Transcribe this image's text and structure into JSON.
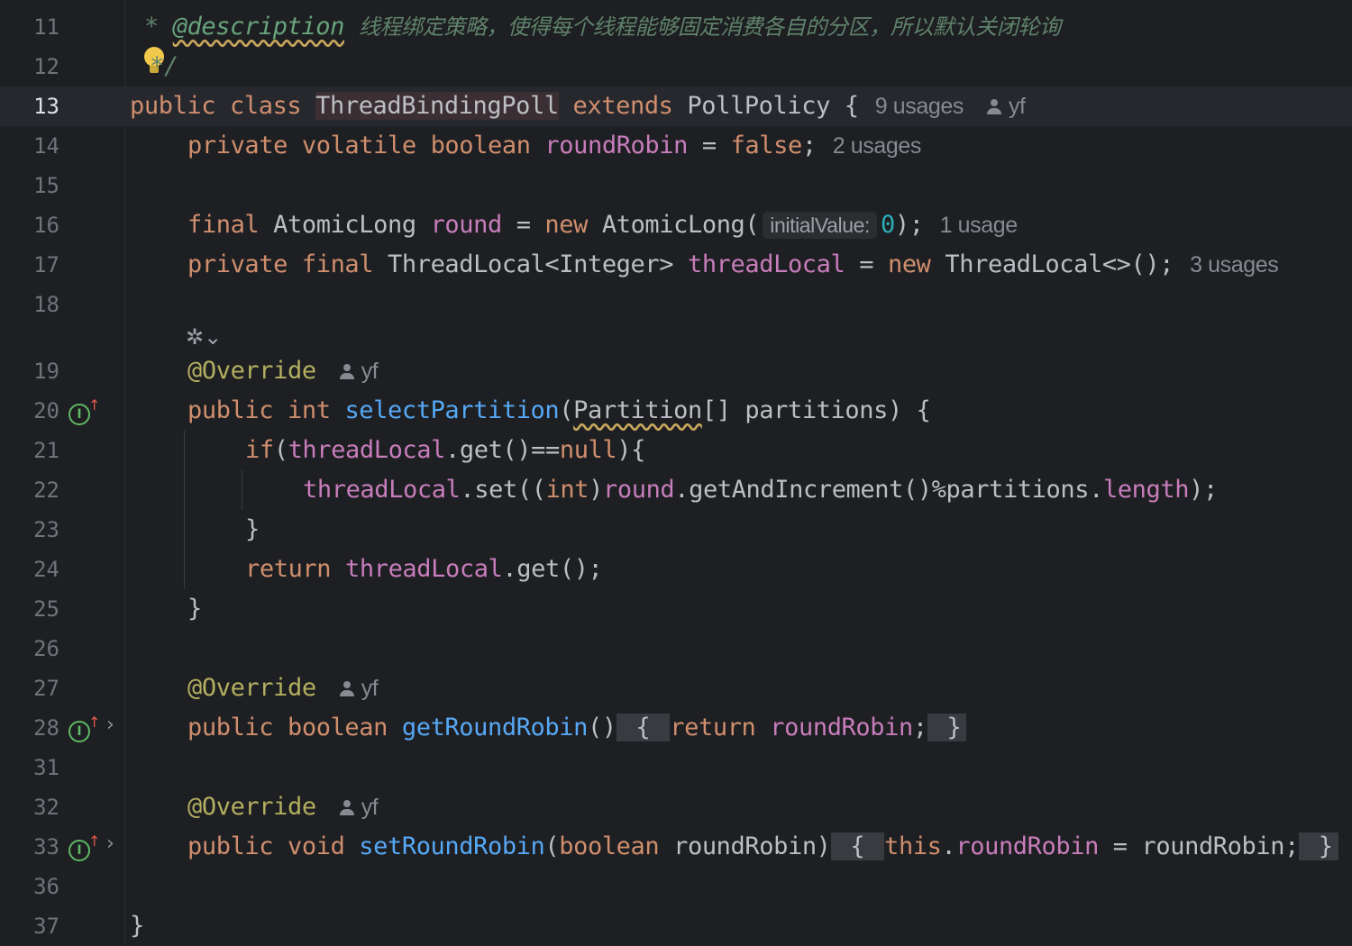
{
  "editor": {
    "line_numbers": [
      "11",
      "12",
      "13",
      "14",
      "15",
      "16",
      "17",
      "18",
      "19",
      "20",
      "21",
      "22",
      "23",
      "24",
      "25",
      "26",
      "27",
      "28",
      "31",
      "32",
      "33",
      "36",
      "37"
    ],
    "lines": {
      "l11": {
        "star": "*",
        "tag": "@description",
        "text": "线程绑定策略，使得每个线程能够固定消费各自的分区，所以默认关闭轮询"
      },
      "l12": {
        "text": "*/"
      },
      "l13": {
        "kw1": "public",
        "kw2": "class",
        "class_name": "ThreadBindingPoll",
        "kw3": "extends",
        "super": "PollPolicy",
        "brace": "{",
        "hint": "9 usages",
        "author": "yf"
      },
      "l14": {
        "kw1": "private",
        "kw2": "volatile",
        "kw3": "boolean",
        "field": "roundRobin",
        "eq": "=",
        "val": "false",
        "semi": ";",
        "hint": "2 usages"
      },
      "l16": {
        "kw1": "final",
        "type": "AtomicLong",
        "field": "round",
        "eq": "=",
        "kw2": "new",
        "ctor": "AtomicLong(",
        "param_hint": "initialValue:",
        "num": "0",
        "end": ");",
        "hint": "1 usage"
      },
      "l17": {
        "kw1": "private",
        "kw2": "final",
        "type": "ThreadLocal<Integer>",
        "field": "threadLocal",
        "eq": "=",
        "kw3": "new",
        "ctor": "ThreadLocal<>();",
        "hint": "3 usages"
      },
      "l19": {
        "ann": "@Override",
        "author": "yf"
      },
      "l20": {
        "kw1": "public",
        "kw2": "int",
        "fn": "selectPartition",
        "p1": "(",
        "ptype": "Partition",
        "rest": "[] partitions) {"
      },
      "l21": {
        "kw": "if",
        "p": "(",
        "field": "threadLocal",
        "rest": ".get()==",
        "kw2": "null",
        "end": "){"
      },
      "l22": {
        "field": "threadLocal",
        "a": ".set((",
        "kw": "int",
        "b": ")",
        "field2": "round",
        "c": ".getAndIncrement()%partitions.",
        "field3": "length",
        "d": ");"
      },
      "l23": {
        "text": "}"
      },
      "l24": {
        "kw": "return",
        "field": "threadLocal",
        "rest": ".get();"
      },
      "l25": {
        "text": "}"
      },
      "l27": {
        "ann": "@Override",
        "author": "yf"
      },
      "l28": {
        "kw1": "public",
        "kw2": "boolean",
        "fn": "getRoundRobin",
        "p": "()",
        "open": " { ",
        "kw3": "return",
        "field": "roundRobin",
        "semi": ";",
        "close": " }"
      },
      "l32": {
        "ann": "@Override",
        "author": "yf"
      },
      "l33": {
        "kw1": "public",
        "kw2": "void",
        "fn": "setRoundRobin",
        "p": "(",
        "kw3": "boolean",
        "rest": " roundRobin)",
        "open": " { ",
        "kw4": "this",
        "dot": ".",
        "field": "roundRobin",
        "rest2": " = roundRobin;",
        "close": " }"
      },
      "l37": {
        "text": "}"
      }
    },
    "gutter_icons": {
      "override_letter": "I",
      "override_arrow": "↑",
      "chevron": "›",
      "chevron_down": "⌄"
    }
  },
  "colors": {
    "background": "#1e1f22",
    "keyword": "#cf8e6d",
    "field": "#c77dbb",
    "function": "#56a8f5",
    "annotation": "#b3ae60",
    "number": "#2aacb8",
    "comment": "#5f826b"
  }
}
